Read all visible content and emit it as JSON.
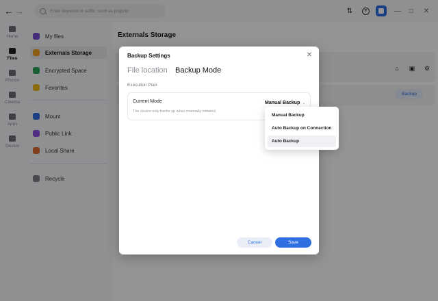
{
  "search": {
    "placeholder": "Enter keyword or suffix, such as png/zip"
  },
  "rail": {
    "items": [
      {
        "label": "Home",
        "icon": "home-icon"
      },
      {
        "label": "Files",
        "icon": "folder-icon"
      },
      {
        "label": "Photos",
        "icon": "image-icon"
      },
      {
        "label": "Cinema",
        "icon": "video-icon"
      },
      {
        "label": "Apps",
        "icon": "grid-icon"
      },
      {
        "label": "Device",
        "icon": "device-icon"
      }
    ]
  },
  "sidebar": {
    "items": [
      {
        "label": "My files",
        "color": "#7b4dd8"
      },
      {
        "label": "Externals Storage",
        "color": "#f0a11f"
      },
      {
        "label": "Encrypted Space",
        "color": "#2aa55a"
      },
      {
        "label": "Favorites",
        "color": "#f0b81f"
      },
      {
        "label": "Mount",
        "color": "#2f6fe0"
      },
      {
        "label": "Public Link",
        "color": "#8a4de0"
      },
      {
        "label": "Local Share",
        "color": "#e06a2f"
      },
      {
        "label": "Recycle",
        "color": "#7a7e86"
      }
    ]
  },
  "main": {
    "title": "Externals Storage",
    "backup_label": "Backup"
  },
  "dialog": {
    "title": "Backup Settings",
    "tabs": [
      {
        "label": "File location"
      },
      {
        "label": "Backup Mode"
      }
    ],
    "section_label": "Execution Plan",
    "mode_label": "Current Mode",
    "mode_value": "Manual Backup",
    "mode_desc": "The device only backs up when manually initiated.",
    "cancel_label": "Cancel",
    "save_label": "Save"
  },
  "dropdown": {
    "options": [
      "Manual Backup",
      "Auto Backup on Connection",
      "Auto Backup"
    ]
  },
  "colors": {
    "accent": "#2f6fe0"
  }
}
